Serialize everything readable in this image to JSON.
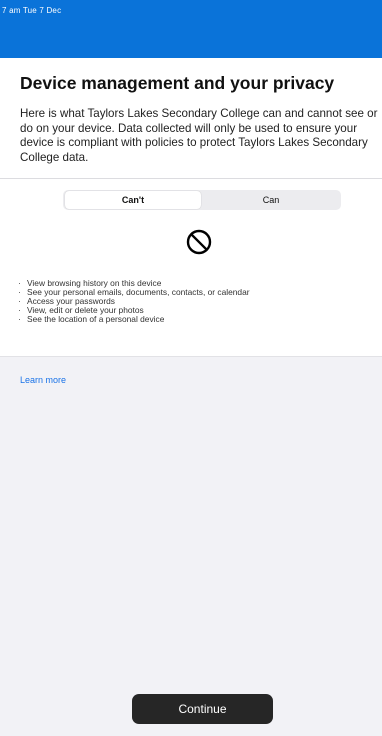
{
  "status_bar": {
    "time": "7 am  Tue 7 Dec"
  },
  "header": {
    "title": "Device management and your privacy",
    "description": "Here is what Taylors Lakes Secondary College can and cannot see or do on your device. Data collected will only be used to ensure your device is compliant with policies to protect Taylors Lakes Secondary College data."
  },
  "segment": {
    "cant_label": "Can't",
    "can_label": "Can",
    "selected": "Can't"
  },
  "cant_list": [
    "View browsing history on this device",
    "See your personal emails, documents, contacts, or calendar",
    "Access your passwords",
    "View, edit or delete your photos",
    "See the location of a personal device"
  ],
  "learn_more": "Learn more",
  "continue_label": "Continue",
  "colors": {
    "header_blue": "#0a73d9",
    "link": "#1a73e8",
    "button": "#262626"
  },
  "icons": {
    "prohibited": "prohibited-icon"
  }
}
